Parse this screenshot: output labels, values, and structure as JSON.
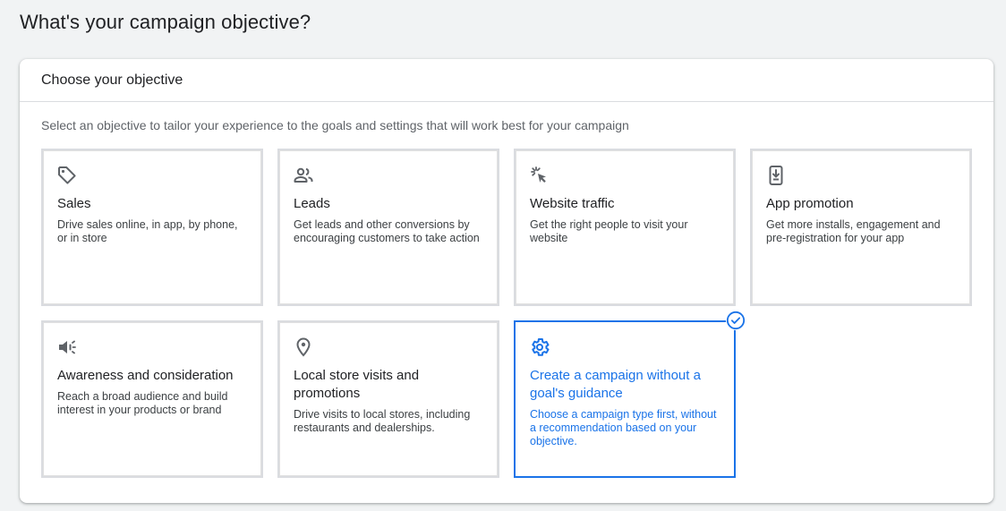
{
  "page": {
    "title": "What's your campaign objective?"
  },
  "objective_card": {
    "header": "Choose your objective",
    "description": "Select an objective to tailor your experience to the goals and settings that will work best for your campaign"
  },
  "objectives": [
    {
      "icon": "tag-icon",
      "title": "Sales",
      "description": "Drive sales online, in app, by phone, or in store",
      "selected": false
    },
    {
      "icon": "people-icon",
      "title": "Leads",
      "description": "Get leads and other conversions by encouraging customers to take action",
      "selected": false
    },
    {
      "icon": "cursor-click-icon",
      "title": "Website traffic",
      "description": "Get the right people to visit your website",
      "selected": false
    },
    {
      "icon": "phone-download-icon",
      "title": "App promotion",
      "description": "Get more installs, engagement and pre-registration for your app",
      "selected": false
    },
    {
      "icon": "megaphone-icon",
      "title": "Awareness and consideration",
      "description": "Reach a broad audience and build interest in your products or brand",
      "selected": false
    },
    {
      "icon": "location-pin-icon",
      "title": "Local store visits and promotions",
      "description": "Drive visits to local stores, including restaurants and dealerships.",
      "selected": false
    },
    {
      "icon": "gear-icon",
      "title": "Create a campaign without a goal's guidance",
      "description": "Choose a campaign type first, without a recommendation based on your objective.",
      "selected": true
    }
  ],
  "colors": {
    "accent": "#1a73e8",
    "icon": "#5f6368"
  }
}
